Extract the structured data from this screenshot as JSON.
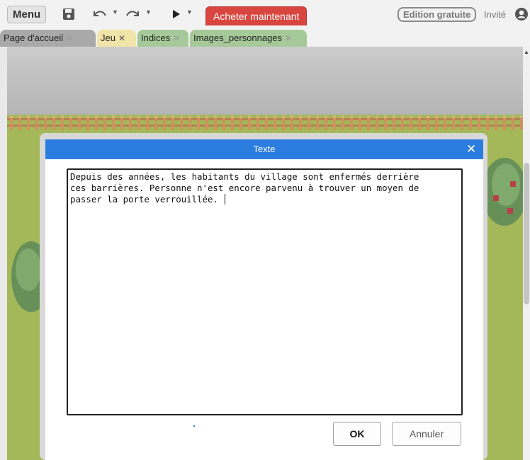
{
  "toolbar": {
    "menu_label": "Menu",
    "buy_label": "Acheter maintenant",
    "edition_label": "Edition gratuite",
    "guest_label": "Invité",
    "icons": [
      "save-icon",
      "undo-icon",
      "redo-icon",
      "play-icon",
      "user-circle-icon"
    ]
  },
  "tabs": [
    {
      "label": "Page d'accueil",
      "color": "#a9a9a9"
    },
    {
      "label": "Jeu",
      "color": "#f1e4a8"
    },
    {
      "label": "Indices",
      "color": "#a6c999"
    },
    {
      "label": "Images_personnages",
      "color": "#a6c999"
    }
  ],
  "tab_close_symbol": "✕",
  "dialog": {
    "title": "Texte",
    "close_symbol": "✕",
    "text": "Depuis des années, les habitants du village sont enfermés derrière\nces barrières. Personne n'est encore parvenu à trouver un moyen de\npasser la porte verrouillée. ",
    "ok_label": "OK",
    "cancel_label": "Annuler"
  },
  "colors": {
    "dialog_header": "#2c7de0",
    "buy_button": "#d9453f",
    "grass": "#9fb44f",
    "fence": "#b37a4a"
  }
}
